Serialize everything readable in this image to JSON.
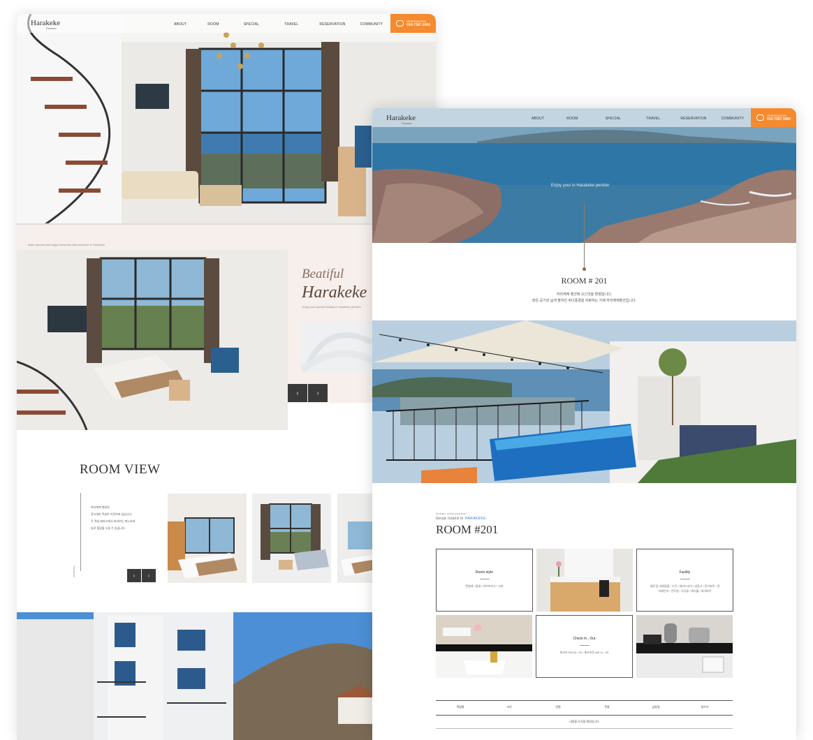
{
  "left_page": {
    "logo": "Harakeke",
    "logo_sub": "Pension",
    "menu": [
      "ABOUT",
      "ROOM",
      "SPECIAL",
      "TRAVEL",
      "RESERVATION",
      "COMMUNITY"
    ],
    "reservation_label": "RESERVATION",
    "reservation_phone": "010-7387-1060",
    "tagline": "Make special and happy memories with someone in Harakeke",
    "beautiful": "Beatiful",
    "brand": "Harakeke",
    "beautiful_sub": "Enjoy your special holiday in Harakeke pension",
    "room_view_title": "ROOM VIEW",
    "room_view_text": [
      "하라케케 펜션은",
      "갯 6개의 객실로 이루어져 있습니다.",
      "각 객실 테라스에서 바라보는 파노라마",
      "뷰로 힐링을 누릴 수 있습니다."
    ],
    "vertical_label": "Harakeke"
  },
  "right_page": {
    "logo": "Harakeke",
    "logo_sub": "Pension",
    "menu": [
      "ABOUT",
      "ROOM",
      "SPECIAL",
      "TRAVEL",
      "RESERVATION",
      "COMMUNITY"
    ],
    "reservation_label": "RESERVATION",
    "reservation_phone": "010-7387-1060",
    "hero_caption": "Enjoy your in Harakeke pention",
    "room_heading": "ROOM # 201",
    "room_desc_1": "하라케케 펜션에 오신것을 환영합니다.",
    "room_desc_2": "맑은 공기와 넓게 펼쳐진 바다풍경을 자랑하는 거제 하라케케펜션입니다.",
    "section_eyebrow": "Ocean view pention",
    "section_sub_prefix": "Geoje Island In",
    "section_sub_highlight": "HARAKEKE.",
    "section_title": "ROOM #201",
    "room_style_title": "Room style",
    "room_style_desc": "퀸침대 / 침대 / 아이브리스 / 소파",
    "facility_title": "Facility",
    "facility_desc": "세면 및 샤워용품 / 수건 / 헤어드라이 / 냉장고 / 전기포트 / 전자레인지 / 인덕션 / 식기류 / 테이블 / 와이파이",
    "checkin_title": "Check In , Out",
    "checkin_desc": "체크인 PM 03 : 00 / 체크아웃 AM 11 : 00",
    "table_headers": [
      "객실명",
      "크기",
      "인원",
      "주중",
      "금요일",
      "성수기"
    ],
    "table_note": "내용을 추가할 예정입니다"
  }
}
